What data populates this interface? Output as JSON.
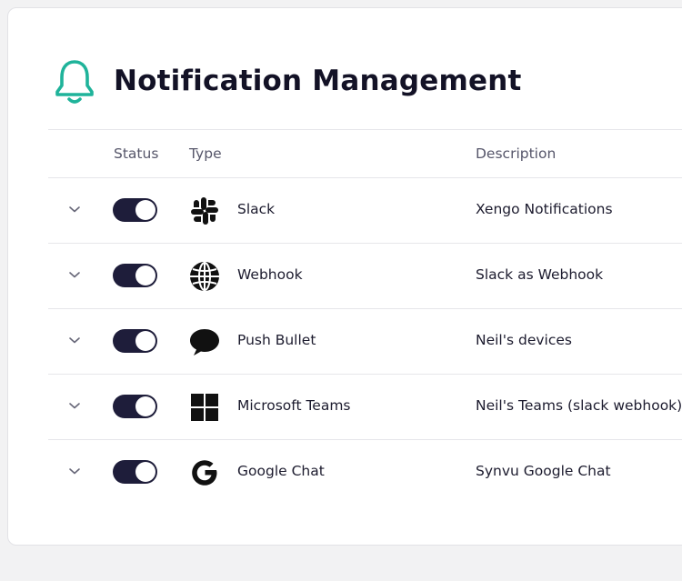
{
  "header": {
    "title": "Notification Management",
    "icon": "bell-icon",
    "accent": "#1fb39a"
  },
  "table": {
    "columns": {
      "status": "Status",
      "type": "Type",
      "description": "Description"
    },
    "rows": [
      {
        "type": "Slack",
        "description": "Xengo Notifications",
        "icon": "slack-icon",
        "enabled": true
      },
      {
        "type": "Webhook",
        "description": "Slack as Webhook",
        "icon": "globe-icon",
        "enabled": true
      },
      {
        "type": "Push Bullet",
        "description": "Neil's devices",
        "icon": "speech-bubble-icon",
        "enabled": true
      },
      {
        "type": "Microsoft Teams",
        "description": "Neil's Teams (slack webhook)",
        "icon": "windows-icon",
        "enabled": true
      },
      {
        "type": "Google Chat",
        "description": "Synvu Google Chat",
        "icon": "google-icon",
        "enabled": true
      }
    ]
  },
  "colors": {
    "toggle_on": "#1e1d3a",
    "text": "#1c1b2e",
    "muted": "#56566a"
  }
}
